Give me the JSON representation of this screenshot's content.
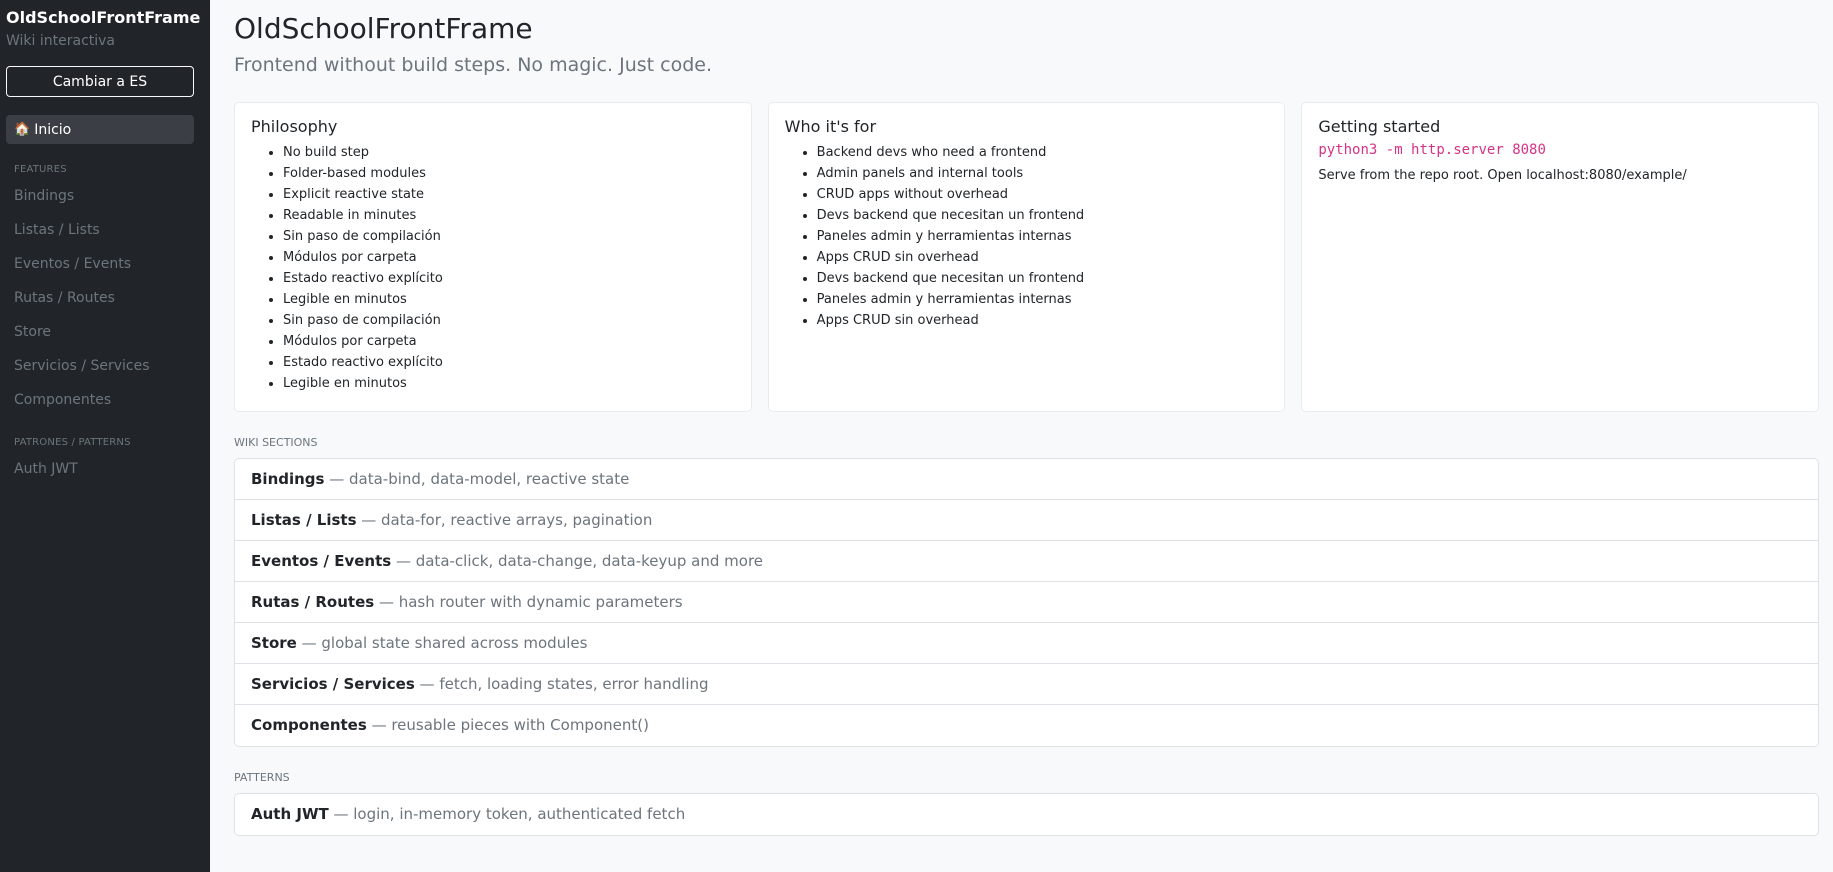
{
  "sidebar": {
    "brand": "OldSchoolFrontFrame",
    "subtitle": "Wiki interactiva",
    "lang_button": "Cambiar a ES",
    "home_icon": "house-icon",
    "home_label": "Inicio",
    "features_heading": "FEATURES",
    "features": [
      {
        "label": "Bindings"
      },
      {
        "label": "Listas / Lists"
      },
      {
        "label": "Eventos / Events"
      },
      {
        "label": "Rutas / Routes"
      },
      {
        "label": "Store"
      },
      {
        "label": "Servicios / Services"
      },
      {
        "label": "Componentes"
      }
    ],
    "patterns_heading": "PATRONES / PATTERNS",
    "patterns": [
      {
        "label": "Auth JWT"
      }
    ]
  },
  "main": {
    "title": "OldSchoolFrontFrame",
    "lead": "Frontend without build steps. No magic. Just code.",
    "cards": {
      "philosophy": {
        "title": "Philosophy",
        "items": [
          "No build step",
          "Folder-based modules",
          "Explicit reactive state",
          "Readable in minutes",
          "Sin paso de compilación",
          "Módulos por carpeta",
          "Estado reactivo explícito",
          "Legible en minutos",
          "Sin paso de compilación",
          "Módulos por carpeta",
          "Estado reactivo explícito",
          "Legible en minutos"
        ]
      },
      "who": {
        "title": "Who it's for",
        "items": [
          "Backend devs who need a frontend",
          "Admin panels and internal tools",
          "CRUD apps without overhead",
          "Devs backend que necesitan un frontend",
          "Paneles admin y herramientas internas",
          "Apps CRUD sin overhead",
          "Devs backend que necesitan un frontend",
          "Paneles admin y herramientas internas",
          "Apps CRUD sin overhead"
        ]
      },
      "start": {
        "title": "Getting started",
        "code": "python3 -m http.server 8080",
        "text": "Serve from the repo root. Open localhost:8080/example/"
      }
    },
    "wiki_heading": "WIKI SECTIONS",
    "wiki_sections": [
      {
        "name": "Bindings",
        "desc": " — data-bind, data-model, reactive state"
      },
      {
        "name": "Listas / Lists",
        "desc": " — data-for, reactive arrays, pagination"
      },
      {
        "name": "Eventos / Events",
        "desc": " — data-click, data-change, data-keyup and more"
      },
      {
        "name": "Rutas / Routes",
        "desc": " — hash router with dynamic parameters"
      },
      {
        "name": "Store",
        "desc": " — global state shared across modules"
      },
      {
        "name": "Servicios / Services",
        "desc": " — fetch, loading states, error handling"
      },
      {
        "name": "Componentes",
        "desc": " — reusable pieces with Component()"
      }
    ],
    "patterns_heading": "PATTERNS",
    "patterns": [
      {
        "name": "Auth JWT",
        "desc": " — login, in-memory token, authenticated fetch"
      }
    ]
  },
  "colors": {
    "sidebar_bg": "#212529",
    "page_bg": "#f8f9fa",
    "code": "#d63384",
    "muted": "#6c757d"
  }
}
